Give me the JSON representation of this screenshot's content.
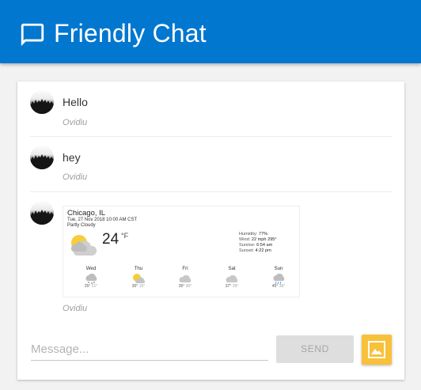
{
  "app": {
    "title": "Friendly Chat",
    "title_icon": "chat-bubble-icon",
    "brand_color": "#0277cf"
  },
  "messages": [
    {
      "text": "Hello",
      "name": "Ovidiu"
    },
    {
      "text": "hey",
      "name": "Ovidiu"
    },
    {
      "text": "",
      "name": "Ovidiu",
      "has_image": true
    }
  ],
  "weather_image": {
    "city": "Chicago, IL",
    "datetime": "Tue, 27 Nov 2018 10:00 AM CST",
    "condition": "Partly Cloudy",
    "temperature": "24",
    "unit": "°F",
    "details": [
      {
        "label": "Humidity:",
        "value": "77%"
      },
      {
        "label": "Wind:",
        "value": "22 mph 295°"
      },
      {
        "label": "Sunrise:",
        "value": "6:54 am"
      },
      {
        "label": "Sunset:",
        "value": "4:22 pm"
      }
    ],
    "forecast": [
      {
        "day": "Wed",
        "hi": "25°",
        "lo": "21°",
        "icon": "snow-icon"
      },
      {
        "day": "Thu",
        "hi": "30°",
        "lo": "15°",
        "icon": "partly-sunny-icon"
      },
      {
        "day": "Fri",
        "hi": "35°",
        "lo": "30°",
        "icon": "cloudy-icon"
      },
      {
        "day": "Sat",
        "hi": "37°",
        "lo": "29°",
        "icon": "cloudy-icon"
      },
      {
        "day": "Sun",
        "hi": "45°",
        "lo": "36°",
        "icon": "rain-icon"
      }
    ]
  },
  "composer": {
    "placeholder": "Message...",
    "send_label": "SEND",
    "image_button_icon": "image-icon",
    "image_button_color": "#f8c13a"
  }
}
